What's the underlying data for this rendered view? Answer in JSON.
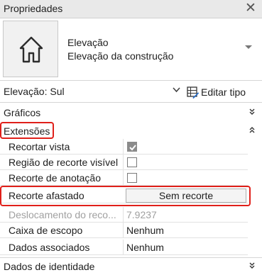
{
  "window": {
    "title": "Propriedades",
    "close_icon": "close-icon"
  },
  "type_selector": {
    "family": "Elevação",
    "type": "Elevação da construção",
    "thumbnail_icon": "house-elevation-icon"
  },
  "view_selector": {
    "value": "Elevação: Sul",
    "edit_type_label": "Editar tipo"
  },
  "sections": {
    "graficos": {
      "label": "Gráficos",
      "state": "collapsed"
    },
    "extensoes": {
      "label": "Extensões",
      "state": "expanded"
    },
    "dados_identidade": {
      "label": "Dados de identidade",
      "state": "collapsed"
    }
  },
  "properties": [
    {
      "name": "Recortar vista",
      "type": "checkbox",
      "checked": true,
      "enabled": false
    },
    {
      "name": "Região de recorte visível",
      "type": "checkbox",
      "checked": false,
      "enabled": true
    },
    {
      "name": "Recorte de anotação",
      "type": "checkbox",
      "checked": false,
      "enabled": true
    },
    {
      "name": "Recorte afastado",
      "type": "button",
      "value": "Sem recorte",
      "enabled": true
    },
    {
      "name": "Deslocamento do reco...",
      "type": "text",
      "value": "7.9237",
      "enabled": false
    },
    {
      "name": "Caixa de escopo",
      "type": "text",
      "value": "Nenhum",
      "enabled": true
    },
    {
      "name": "Dados associados",
      "type": "text",
      "value": "Nenhum",
      "enabled": true
    }
  ],
  "colors": {
    "highlight": "#e0201a",
    "title_bar": "#e9e9e9"
  }
}
